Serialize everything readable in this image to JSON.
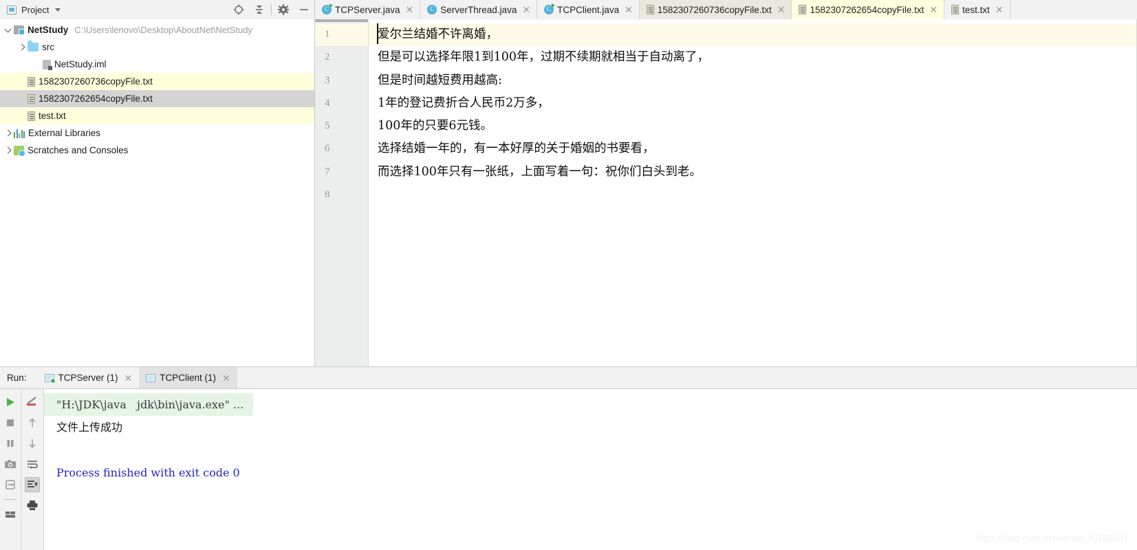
{
  "project_panel": {
    "title": "Project",
    "icons": [
      "project-window-icon",
      "locate-icon",
      "collapse-all-icon",
      "settings-gear-icon",
      "hide-icon"
    ],
    "tree": [
      {
        "label": "NetStudy",
        "path": "C:\\Users\\lenovo\\Desktop\\AboutNet\\NetStudy",
        "icon": "module-icon",
        "arrow": "down",
        "indent": 0,
        "bold": true,
        "highlight": "none"
      },
      {
        "label": "src",
        "path": "",
        "icon": "folder-icon",
        "arrow": "right",
        "indent": 1,
        "bold": false,
        "highlight": "none"
      },
      {
        "label": "NetStudy.iml",
        "path": "",
        "icon": "iml-file-icon",
        "arrow": "none",
        "indent": 2,
        "bold": false,
        "highlight": "none"
      },
      {
        "label": "1582307260736copyFile.txt",
        "path": "",
        "icon": "txt-file-icon",
        "arrow": "none",
        "indent": 1,
        "bold": false,
        "highlight": "yellow"
      },
      {
        "label": "1582307262654copyFile.txt",
        "path": "",
        "icon": "txt-file-icon",
        "arrow": "none",
        "indent": 1,
        "bold": false,
        "highlight": "grey"
      },
      {
        "label": "test.txt",
        "path": "",
        "icon": "txt-file-icon",
        "arrow": "none",
        "indent": 1,
        "bold": false,
        "highlight": "yellow"
      },
      {
        "label": "External Libraries",
        "path": "",
        "icon": "libraries-icon",
        "arrow": "right",
        "indent": 0,
        "bold": false,
        "highlight": "none"
      },
      {
        "label": "Scratches and Consoles",
        "path": "",
        "icon": "scratches-icon",
        "arrow": "right",
        "indent": 0,
        "bold": false,
        "highlight": "none"
      }
    ]
  },
  "editor_tabs": [
    {
      "label": "TCPServer.java",
      "icon": "java-class-runnable-icon",
      "state": "normal"
    },
    {
      "label": "ServerThread.java",
      "icon": "java-class-icon",
      "state": "normal"
    },
    {
      "label": "TCPClient.java",
      "icon": "java-class-runnable-icon",
      "state": "normal"
    },
    {
      "label": "1582307260736copyFile.txt",
      "icon": "txt-file-icon",
      "state": "modified"
    },
    {
      "label": "1582307262654copyFile.txt",
      "icon": "txt-file-icon",
      "state": "active"
    },
    {
      "label": "test.txt",
      "icon": "txt-file-icon",
      "state": "normal"
    }
  ],
  "editor": {
    "line_numbers": [
      "1",
      "2",
      "3",
      "4",
      "5",
      "6",
      "7",
      "8"
    ],
    "lines": [
      "爱尔兰结婚不许离婚，",
      "但是可以选择年限1到100年，过期不续期就相当于自动离了，",
      "但是时间越短费用越高:",
      "1年的登记费折合人民币2万多，",
      "100年的只要6元钱。",
      "选择结婚一年的，有一本好厚的关于婚姻的书要看，",
      "而选择100年只有一张纸，上面写着一句：祝你们白头到老。",
      ""
    ],
    "current_line": 1
  },
  "run_panel": {
    "label": "Run:",
    "tabs": [
      {
        "label": "TCPServer (1)",
        "icon": "run-config-running-icon",
        "active": false
      },
      {
        "label": "TCPClient (1)",
        "icon": "run-config-icon",
        "active": true
      }
    ],
    "toolbar_left": [
      "rerun-play-icon",
      "stop-icon",
      "pause-icon",
      "camera-icon",
      "export-icon",
      "layout-icon"
    ],
    "toolbar_right": [
      "soft-wrap-icon",
      "up-arrow-icon",
      "down-arrow-icon",
      "wrap-text-icon",
      "scroll-to-end-icon",
      "print-icon"
    ],
    "console": [
      {
        "text": "\"H:\\JDK\\java   jdk\\bin\\java.exe\" ...",
        "kind": "cmd"
      },
      {
        "text": "文件上传成功",
        "kind": "out"
      },
      {
        "text": "",
        "kind": "out"
      },
      {
        "text": "Process finished with exit code 0",
        "kind": "exit"
      }
    ]
  },
  "watermark": "https://blog.csdn.net/weixin_45238600",
  "colors": {
    "tab_active_bg": "#ffffdf",
    "tab_modified_bg": "#e8e8e0",
    "tree_selected_bg": "#d4d4d4",
    "tree_highlight_bg": "#ffffdc",
    "console_cmd_bg": "#e6f4e6",
    "console_exit_fg": "#2424c8",
    "java_icon": "#51b0db"
  }
}
